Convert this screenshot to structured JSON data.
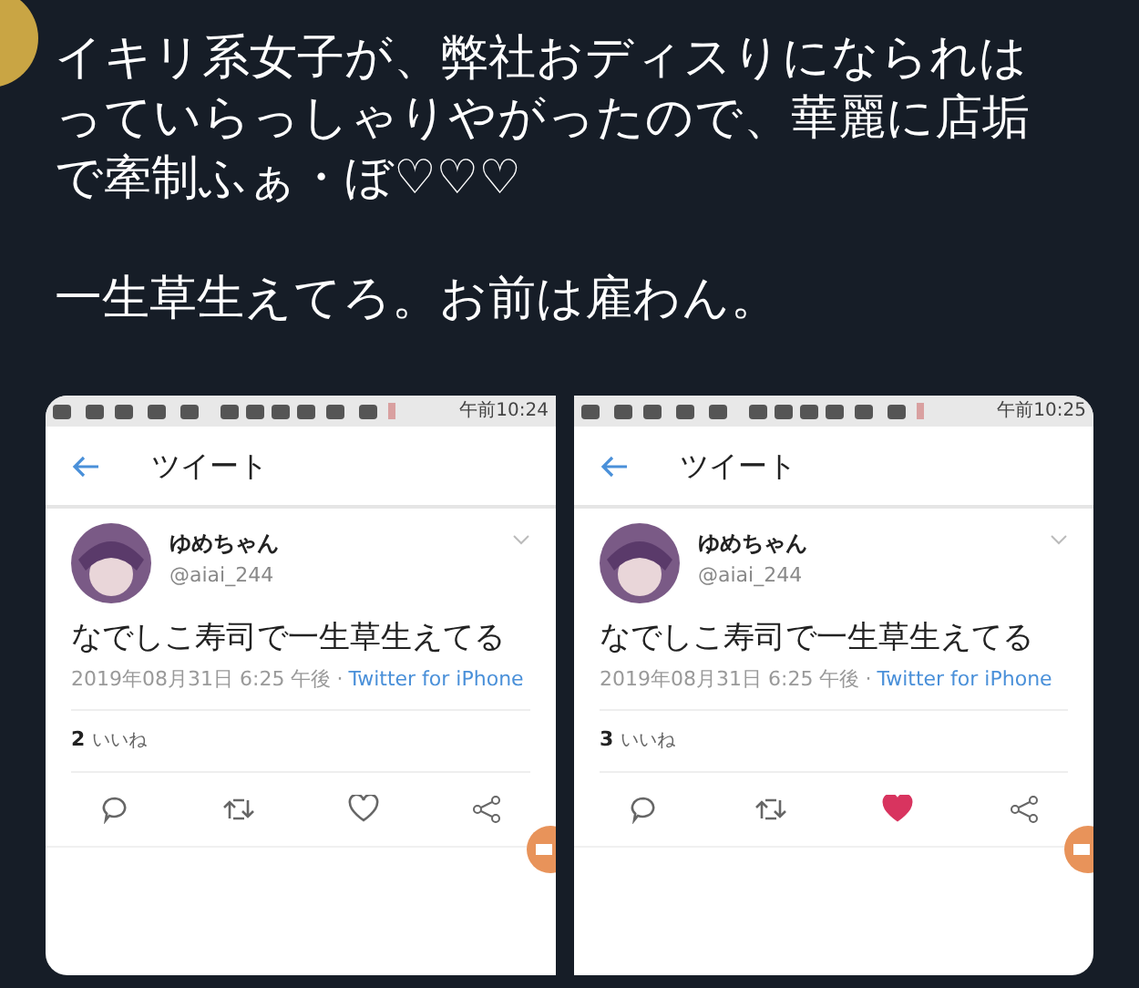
{
  "tweet": {
    "paragraphs": [
      [
        "イキリ系女子が、弊社おディスりになられは",
        "っていらっしゃりやがったので、華麗に店垢",
        "で牽制ふぁ・ぼ♡♡♡"
      ],
      [
        "一生草生えてろ。お前は雇わん。"
      ]
    ]
  },
  "screenshots": [
    {
      "status_time": "午前10:24",
      "header_title": "ツイート",
      "name": "ゆめちゃん",
      "handle": "@aiai_244",
      "text": "なでしこ寿司で一生草生えてる",
      "date": "2019年08月31日 6:25 午後",
      "separator": "·",
      "source": "Twitter for iPhone",
      "like_count": "2",
      "like_label": "いいね",
      "liked": false
    },
    {
      "status_time": "午前10:25",
      "header_title": "ツイート",
      "name": "ゆめちゃん",
      "handle": "@aiai_244",
      "text": "なでしこ寿司で一生草生えてる",
      "date": "2019年08月31日 6:25 午後",
      "separator": "·",
      "source": "Twitter for iPhone",
      "like_count": "3",
      "like_label": "いいね",
      "liked": true
    }
  ]
}
